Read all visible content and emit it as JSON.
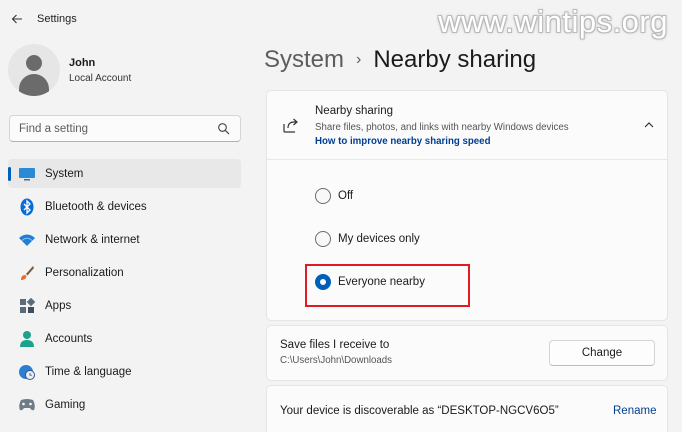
{
  "window": {
    "title": "Settings",
    "watermark": "www.wintips.org"
  },
  "profile": {
    "name": "John",
    "account_type": "Local Account"
  },
  "search": {
    "placeholder": "Find a setting"
  },
  "sidebar": {
    "items": [
      {
        "label": "System",
        "icon": "system-icon",
        "active": true
      },
      {
        "label": "Bluetooth & devices",
        "icon": "bluetooth-icon"
      },
      {
        "label": "Network & internet",
        "icon": "wifi-icon"
      },
      {
        "label": "Personalization",
        "icon": "brush-icon"
      },
      {
        "label": "Apps",
        "icon": "apps-icon"
      },
      {
        "label": "Accounts",
        "icon": "accounts-icon"
      },
      {
        "label": "Time & language",
        "icon": "clock-globe-icon"
      },
      {
        "label": "Gaming",
        "icon": "gamepad-icon"
      }
    ]
  },
  "breadcrumb": {
    "parent": "System",
    "separator": "›",
    "current": "Nearby sharing"
  },
  "nearby_sharing": {
    "title": "Nearby sharing",
    "description": "Share files, photos, and links with nearby Windows devices",
    "link": "How to improve nearby sharing speed",
    "options": [
      {
        "label": "Off",
        "selected": false
      },
      {
        "label": "My devices only",
        "selected": false
      },
      {
        "label": "Everyone nearby",
        "selected": true
      }
    ]
  },
  "save_files": {
    "title": "Save files I receive to",
    "path": "C:\\Users\\John\\Downloads",
    "button": "Change"
  },
  "device": {
    "text": "Your device is discoverable as “DESKTOP-NGCV6O5”",
    "rename": "Rename"
  },
  "colors": {
    "accent": "#005fb8",
    "link": "#003e92",
    "highlight": "#e01b24",
    "background": "#f3f3f3"
  }
}
